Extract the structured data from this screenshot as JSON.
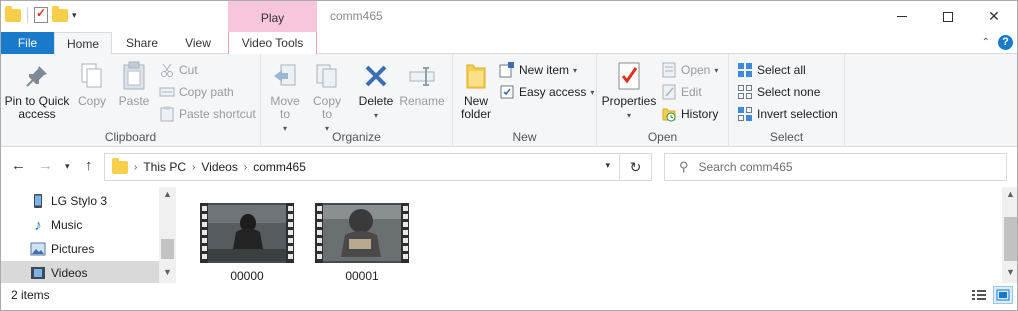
{
  "window": {
    "title": "comm465",
    "context_tab_header": "Play",
    "controls": {
      "minimize": "—",
      "maximize": "☐",
      "close": "✕"
    }
  },
  "tabs": {
    "file": "File",
    "home": "Home",
    "share": "Share",
    "view": "View",
    "video_tools": "Video Tools"
  },
  "ribbon": {
    "clipboard": {
      "label": "Clipboard",
      "pin": "Pin to Quick access",
      "copy": "Copy",
      "paste": "Paste",
      "cut": "Cut",
      "copy_path": "Copy path",
      "paste_shortcut": "Paste shortcut"
    },
    "organize": {
      "label": "Organize",
      "move_to": "Move to",
      "copy_to": "Copy to",
      "delete": "Delete",
      "rename": "Rename"
    },
    "new": {
      "label": "New",
      "new_folder": "New folder",
      "new_item": "New item",
      "easy_access": "Easy access"
    },
    "open": {
      "label": "Open",
      "properties": "Properties",
      "open": "Open",
      "edit": "Edit",
      "history": "History"
    },
    "select": {
      "label": "Select",
      "select_all": "Select all",
      "select_none": "Select none",
      "invert_selection": "Invert selection"
    }
  },
  "address": {
    "crumbs": [
      "This PC",
      "Videos",
      "comm465"
    ],
    "search_placeholder": "Search comm465"
  },
  "nav_pane": {
    "items": [
      {
        "label": "LG Stylo 3",
        "icon": "phone-icon"
      },
      {
        "label": "Music",
        "icon": "music-icon"
      },
      {
        "label": "Pictures",
        "icon": "pictures-icon"
      },
      {
        "label": "Videos",
        "icon": "videos-icon",
        "selected": true
      }
    ]
  },
  "files": [
    {
      "name": "00000",
      "type": "video"
    },
    {
      "name": "00001",
      "type": "video"
    }
  ],
  "status": {
    "item_count": "2 items"
  },
  "colors": {
    "accent": "#1979ca",
    "context_tab": "#f7c5dc",
    "folder": "#f7cf4a",
    "delete_x": "#3c6eb4"
  }
}
